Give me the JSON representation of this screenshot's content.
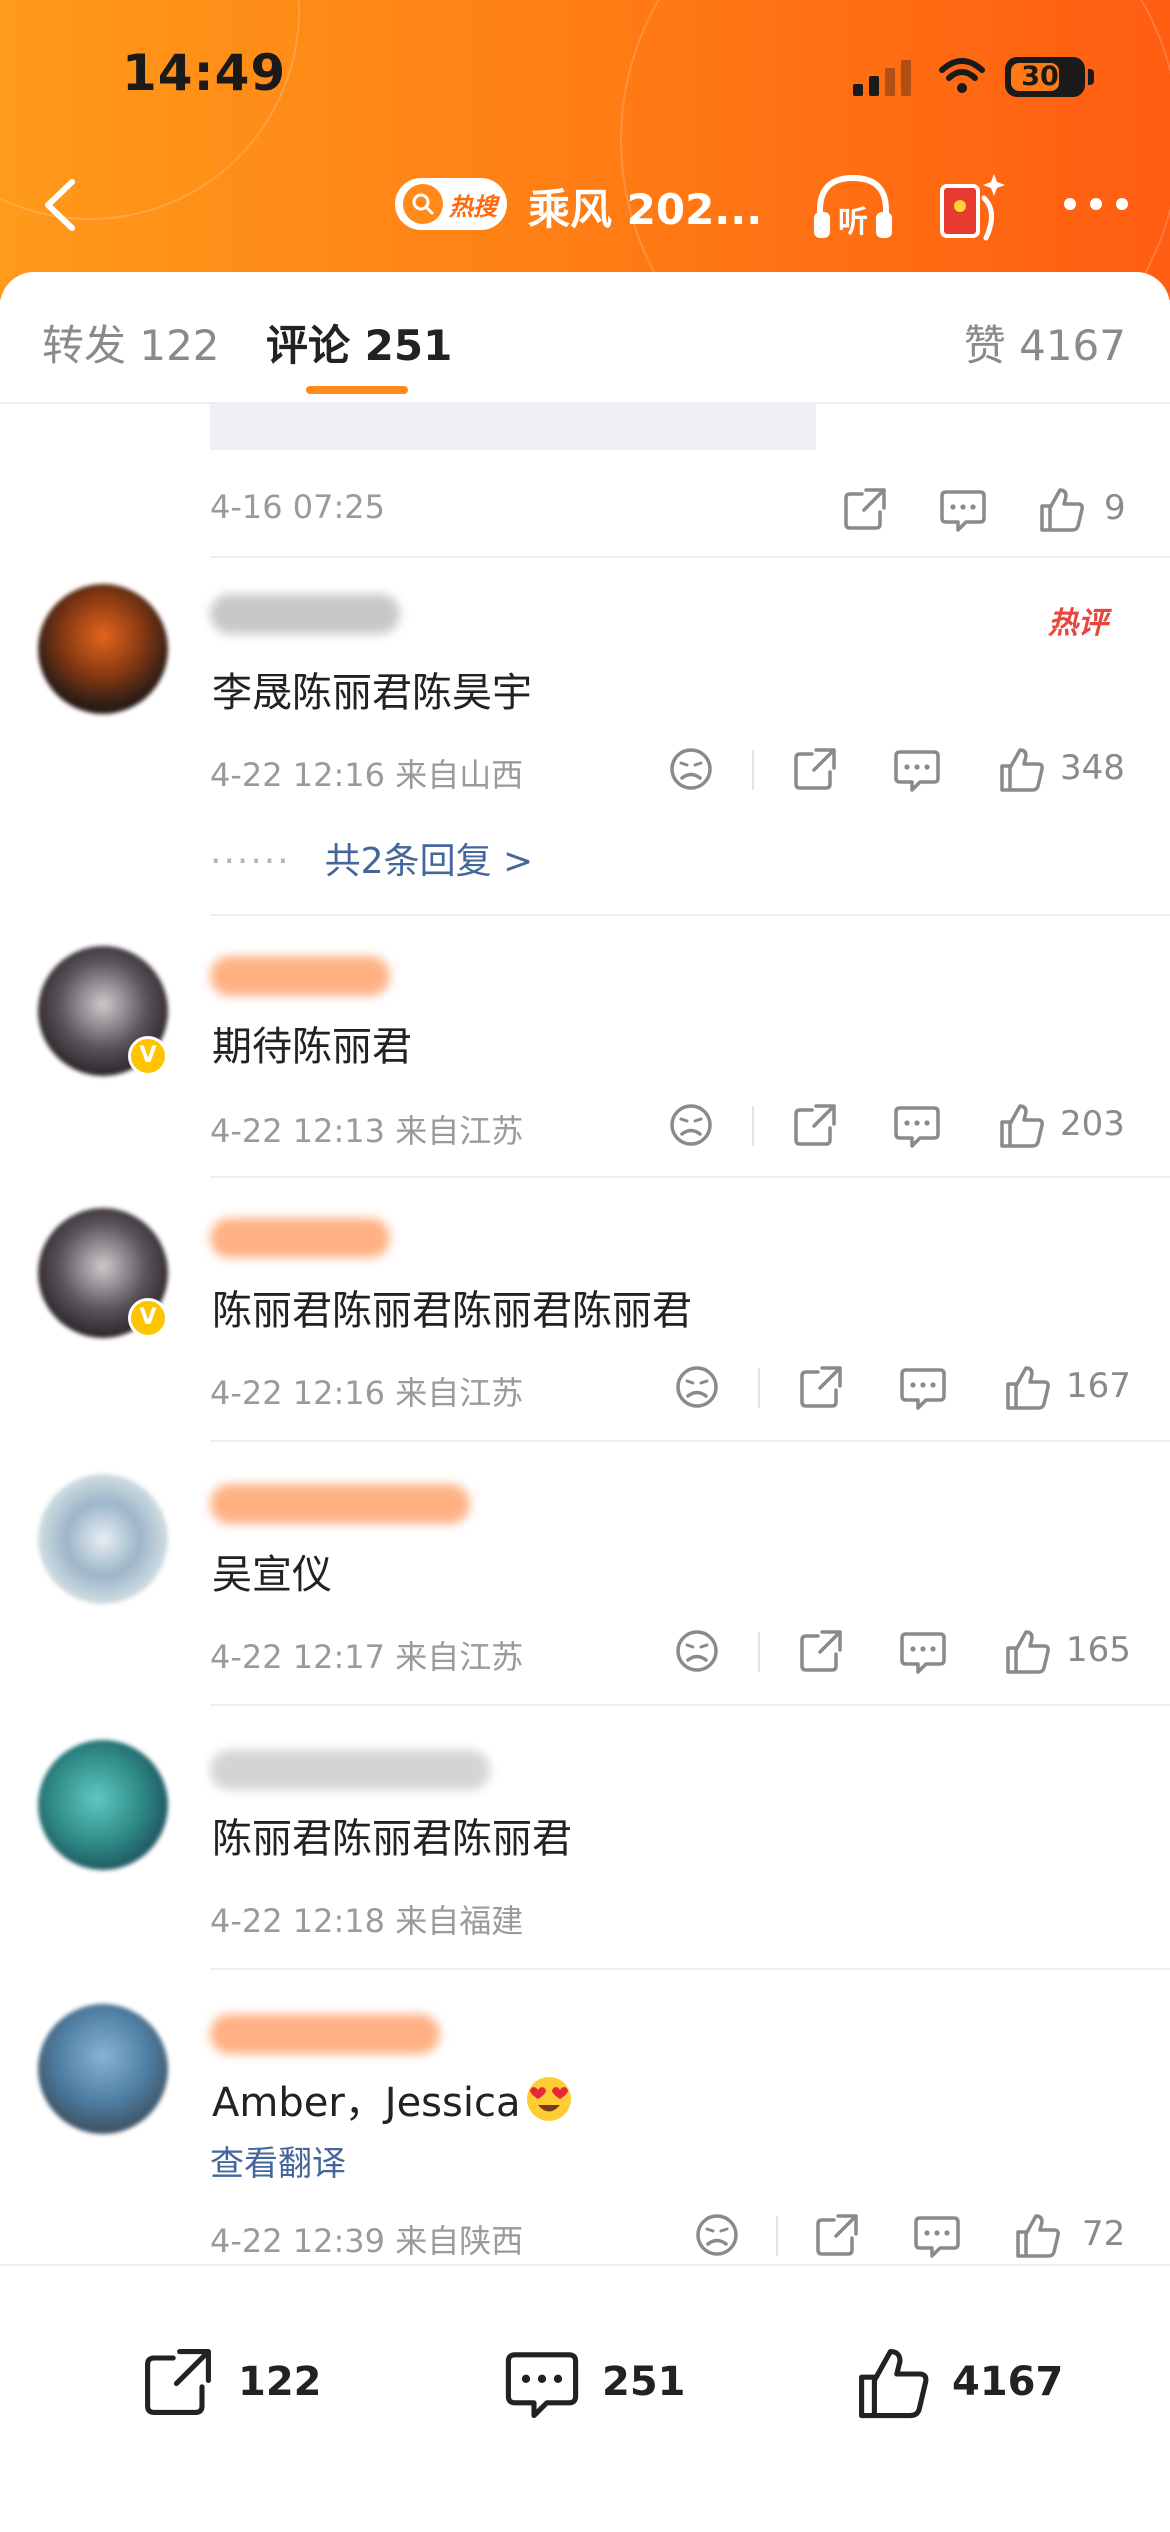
{
  "status_bar": {
    "time": "14:49",
    "battery": "30"
  },
  "nav": {
    "hot_label": "热搜",
    "title": "乘风 202...",
    "listen_label": "听"
  },
  "tabs": {
    "repost": "转发 122",
    "comment": "评论 251",
    "like": "赞 4167"
  },
  "top_post": {
    "time": "4-16 07:25",
    "likes": "9"
  },
  "comments": [
    {
      "text": "李晟陈丽君陈昊宇",
      "meta": "4-22 12:16 来自山西",
      "likes": "348",
      "hot_tag": "热评",
      "replies": "共2条回复 >"
    },
    {
      "text": "期待陈丽君",
      "meta": "4-22 12:13 来自江苏",
      "likes": "203"
    },
    {
      "text": "陈丽君陈丽君陈丽君陈丽君",
      "meta": "4-22 12:16 来自江苏",
      "likes": "167"
    },
    {
      "text": "吴宣仪",
      "meta": "4-22 12:17 来自江苏",
      "likes": "165"
    },
    {
      "text": "陈丽君陈丽君陈丽君",
      "meta": "4-22 12:18 来自福建"
    },
    {
      "text": "Amber，Jessica",
      "meta": "4-22 12:39 来自陕西",
      "likes": "72",
      "translate": "查看翻译"
    }
  ],
  "bottom_bar": {
    "repost": "122",
    "comment": "251",
    "like": "4167"
  },
  "colors": {
    "accent": "#ff7a14",
    "link": "#45669b",
    "hot": "#e8453c"
  }
}
